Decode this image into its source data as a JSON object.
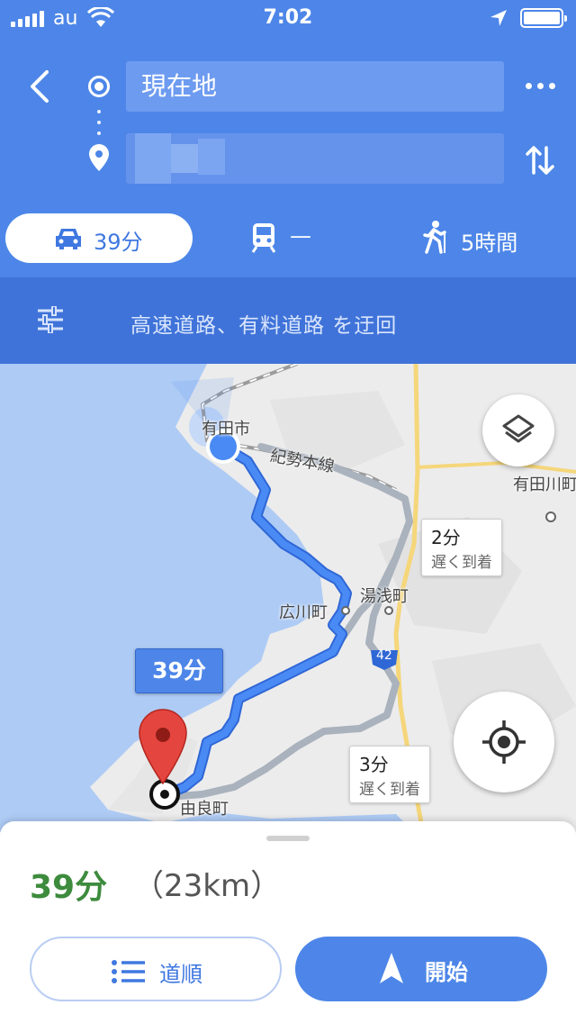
{
  "status_bar": {
    "carrier": "au",
    "time": "7:02"
  },
  "search": {
    "origin": "現在地",
    "destination": ""
  },
  "modes": {
    "drive": "39分",
    "transit": "—",
    "walk": "5時間"
  },
  "options": {
    "label": "高速道路、有料道路 を迂回"
  },
  "map": {
    "labels": {
      "city": "有田市",
      "line": "紀勢本線",
      "arida_river": "有田川町",
      "yuasa": "湯浅町",
      "hirogawa": "広川町",
      "yura": "由良町",
      "road_number": "42"
    },
    "route_label": "39分",
    "alt_routes": [
      {
        "time": "2分",
        "note": "遅く到着"
      },
      {
        "time": "3分",
        "note": "遅く到着"
      }
    ],
    "colors": {
      "route": "#4285f4",
      "water": "#aecbf5",
      "land": "#ececec",
      "alt_route": "#a9b2bd"
    }
  },
  "sheet": {
    "duration": "39分",
    "distance": "（23km）",
    "steps_button": "道順",
    "start_button": "開始"
  },
  "icons": [
    "back-icon",
    "origin-icon",
    "destination-pin-icon",
    "more-icon",
    "swap-icon",
    "car-icon",
    "train-icon",
    "walk-icon",
    "tune-icon",
    "layers-icon",
    "my-location-icon",
    "list-icon",
    "navigation-arrow-icon",
    "destination-marker-icon"
  ]
}
